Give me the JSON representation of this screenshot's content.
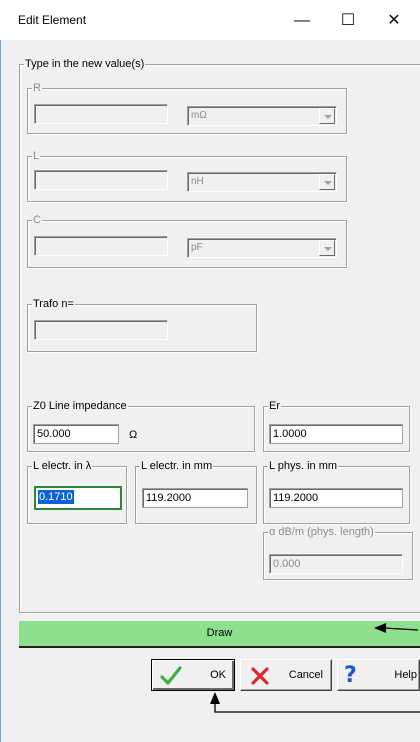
{
  "window": {
    "title": "Edit Element",
    "minimize_glyph": "—",
    "maximize_glyph": "☐",
    "close_glyph": "✕"
  },
  "outer_group": {
    "legend": "Type in the new value(s)"
  },
  "r_group": {
    "legend": "R",
    "value": "",
    "unit": "mΩ"
  },
  "l_group": {
    "legend": "L",
    "value": "",
    "unit": "nH"
  },
  "c_group": {
    "legend": "C",
    "value": "",
    "unit": "pF"
  },
  "trafo_group": {
    "legend": "Trafo n=",
    "value": ""
  },
  "z0_group": {
    "legend": "Z0 Line impedance",
    "value": "50.000",
    "unit": "Ω"
  },
  "er_group": {
    "legend": "Er",
    "value": "1.0000"
  },
  "l_electr_lambda": {
    "legend": "L electr. in λ",
    "value": "0.1710"
  },
  "l_electr_mm": {
    "legend": "L electr. in mm",
    "value": "119.2000"
  },
  "l_phys_mm": {
    "legend": "L phys. in mm",
    "value": "119.2000"
  },
  "alpha_group": {
    "legend": "α dB/m (phys. length)",
    "value": "0.000"
  },
  "draw": {
    "label": "Draw"
  },
  "buttons": {
    "ok": "OK",
    "cancel": "Cancel",
    "help": "Help"
  },
  "icons": {
    "ok": "checkmark-icon",
    "cancel": "cross-icon",
    "help": "question-mark-icon"
  },
  "colors": {
    "draw_bar": "#8ee08e",
    "ok_check": "#3cb043",
    "cancel_cross": "#e0262b",
    "help_q": "#1e5bc6",
    "focus_border": "#2a8a3a",
    "selection": "#0a64d6"
  }
}
